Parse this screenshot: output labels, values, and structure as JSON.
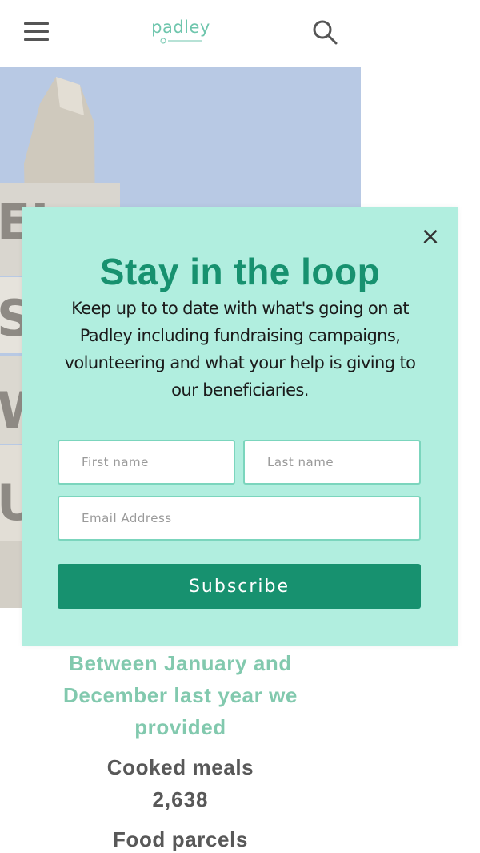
{
  "header": {
    "menu_icon": "hamburger-menu-icon",
    "logo_text": "padley",
    "search_icon": "search-icon"
  },
  "stats": {
    "heading": "Between January and December last year we provided",
    "items": [
      {
        "label": "Cooked meals",
        "value": "2,638"
      },
      {
        "label": "Food parcels",
        "value": ""
      }
    ]
  },
  "popup": {
    "close_label": "×",
    "title": "Stay in the loop",
    "description": "Keep up to to date with what's going on at Padley including fundraising campaigns, volunteering and what your help is giving to our beneficiaries.",
    "first_name_placeholder": "First name",
    "last_name_placeholder": "Last name",
    "email_placeholder": "Email Address",
    "subscribe_label": "Subscribe"
  },
  "colors": {
    "brand_green": "#17916f",
    "popup_background": "#b1eedf",
    "heading_green": "#82c9ae"
  }
}
